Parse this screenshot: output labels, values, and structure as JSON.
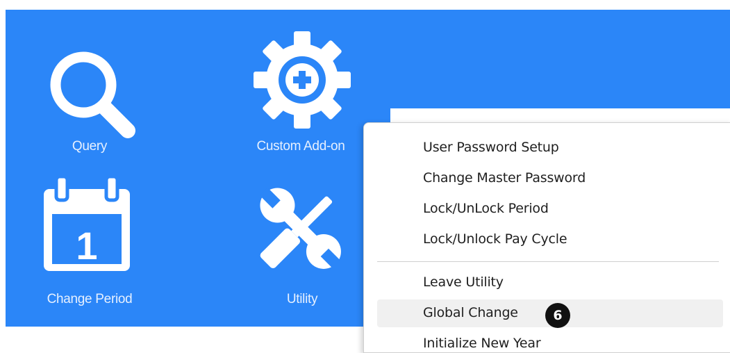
{
  "tiles": [
    {
      "label": "Query",
      "icon": "search-icon"
    },
    {
      "label": "Custom Add-on",
      "icon": "gear-plus-icon"
    },
    {
      "label": "Change Period",
      "icon": "calendar-icon",
      "icon_text": "1"
    },
    {
      "label": "Utility",
      "icon": "wrench-screwdriver-icon"
    }
  ],
  "menu": {
    "items": [
      {
        "label": "User Password Setup"
      },
      {
        "label": "Change Master Password"
      },
      {
        "label": "Lock/UnLock Period"
      },
      {
        "label": "Lock/Unlock Pay Cycle"
      },
      {
        "label": "Leave Utility"
      },
      {
        "label": "Global Change",
        "highlighted": true,
        "badge": "6"
      },
      {
        "label": "Initialize New Year"
      }
    ]
  },
  "colors": {
    "panel_bg": "#2b86f8",
    "icon": "#ffffff",
    "menu_highlight": "#f0f0f0",
    "badge_bg": "#111111"
  }
}
